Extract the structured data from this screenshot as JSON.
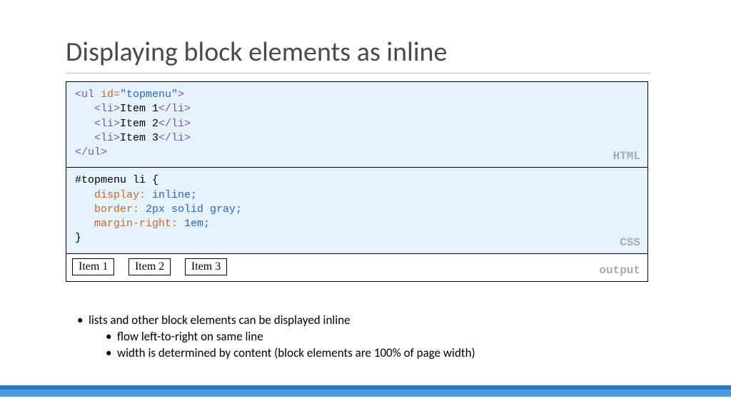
{
  "title": "Displaying block elements as inline",
  "panels": {
    "html": {
      "label": "HTML",
      "lines": {
        "ul_open_pre": "<ul ",
        "ul_attr_name": "id=",
        "ul_attr_val": "\"topmenu\"",
        "ul_open_post": ">",
        "li1_open": "   <li>",
        "li1_text": "Item 1",
        "li1_close": "</li>",
        "li2_open": "   <li>",
        "li2_text": "Item 2",
        "li2_close": "</li>",
        "li3_open": "   <li>",
        "li3_text": "Item 3",
        "li3_close": "</li>",
        "ul_close": "</ul>"
      }
    },
    "css": {
      "label": "CSS",
      "selector": "#topmenu li {",
      "prop1": "   display:",
      "val1": " inline;",
      "prop2": "   border:",
      "val2": " 2px solid gray;",
      "prop3": "   margin-right:",
      "val3": " 1em;",
      "close": "}"
    },
    "output": {
      "label": "output",
      "items": [
        "Item 1",
        "Item 2",
        "Item 3"
      ]
    }
  },
  "notes": {
    "main": "lists and other block elements can be displayed inline",
    "sub1": "flow left-to-right on same line",
    "sub2": "width is determined by content (block elements are 100% of page width)"
  }
}
